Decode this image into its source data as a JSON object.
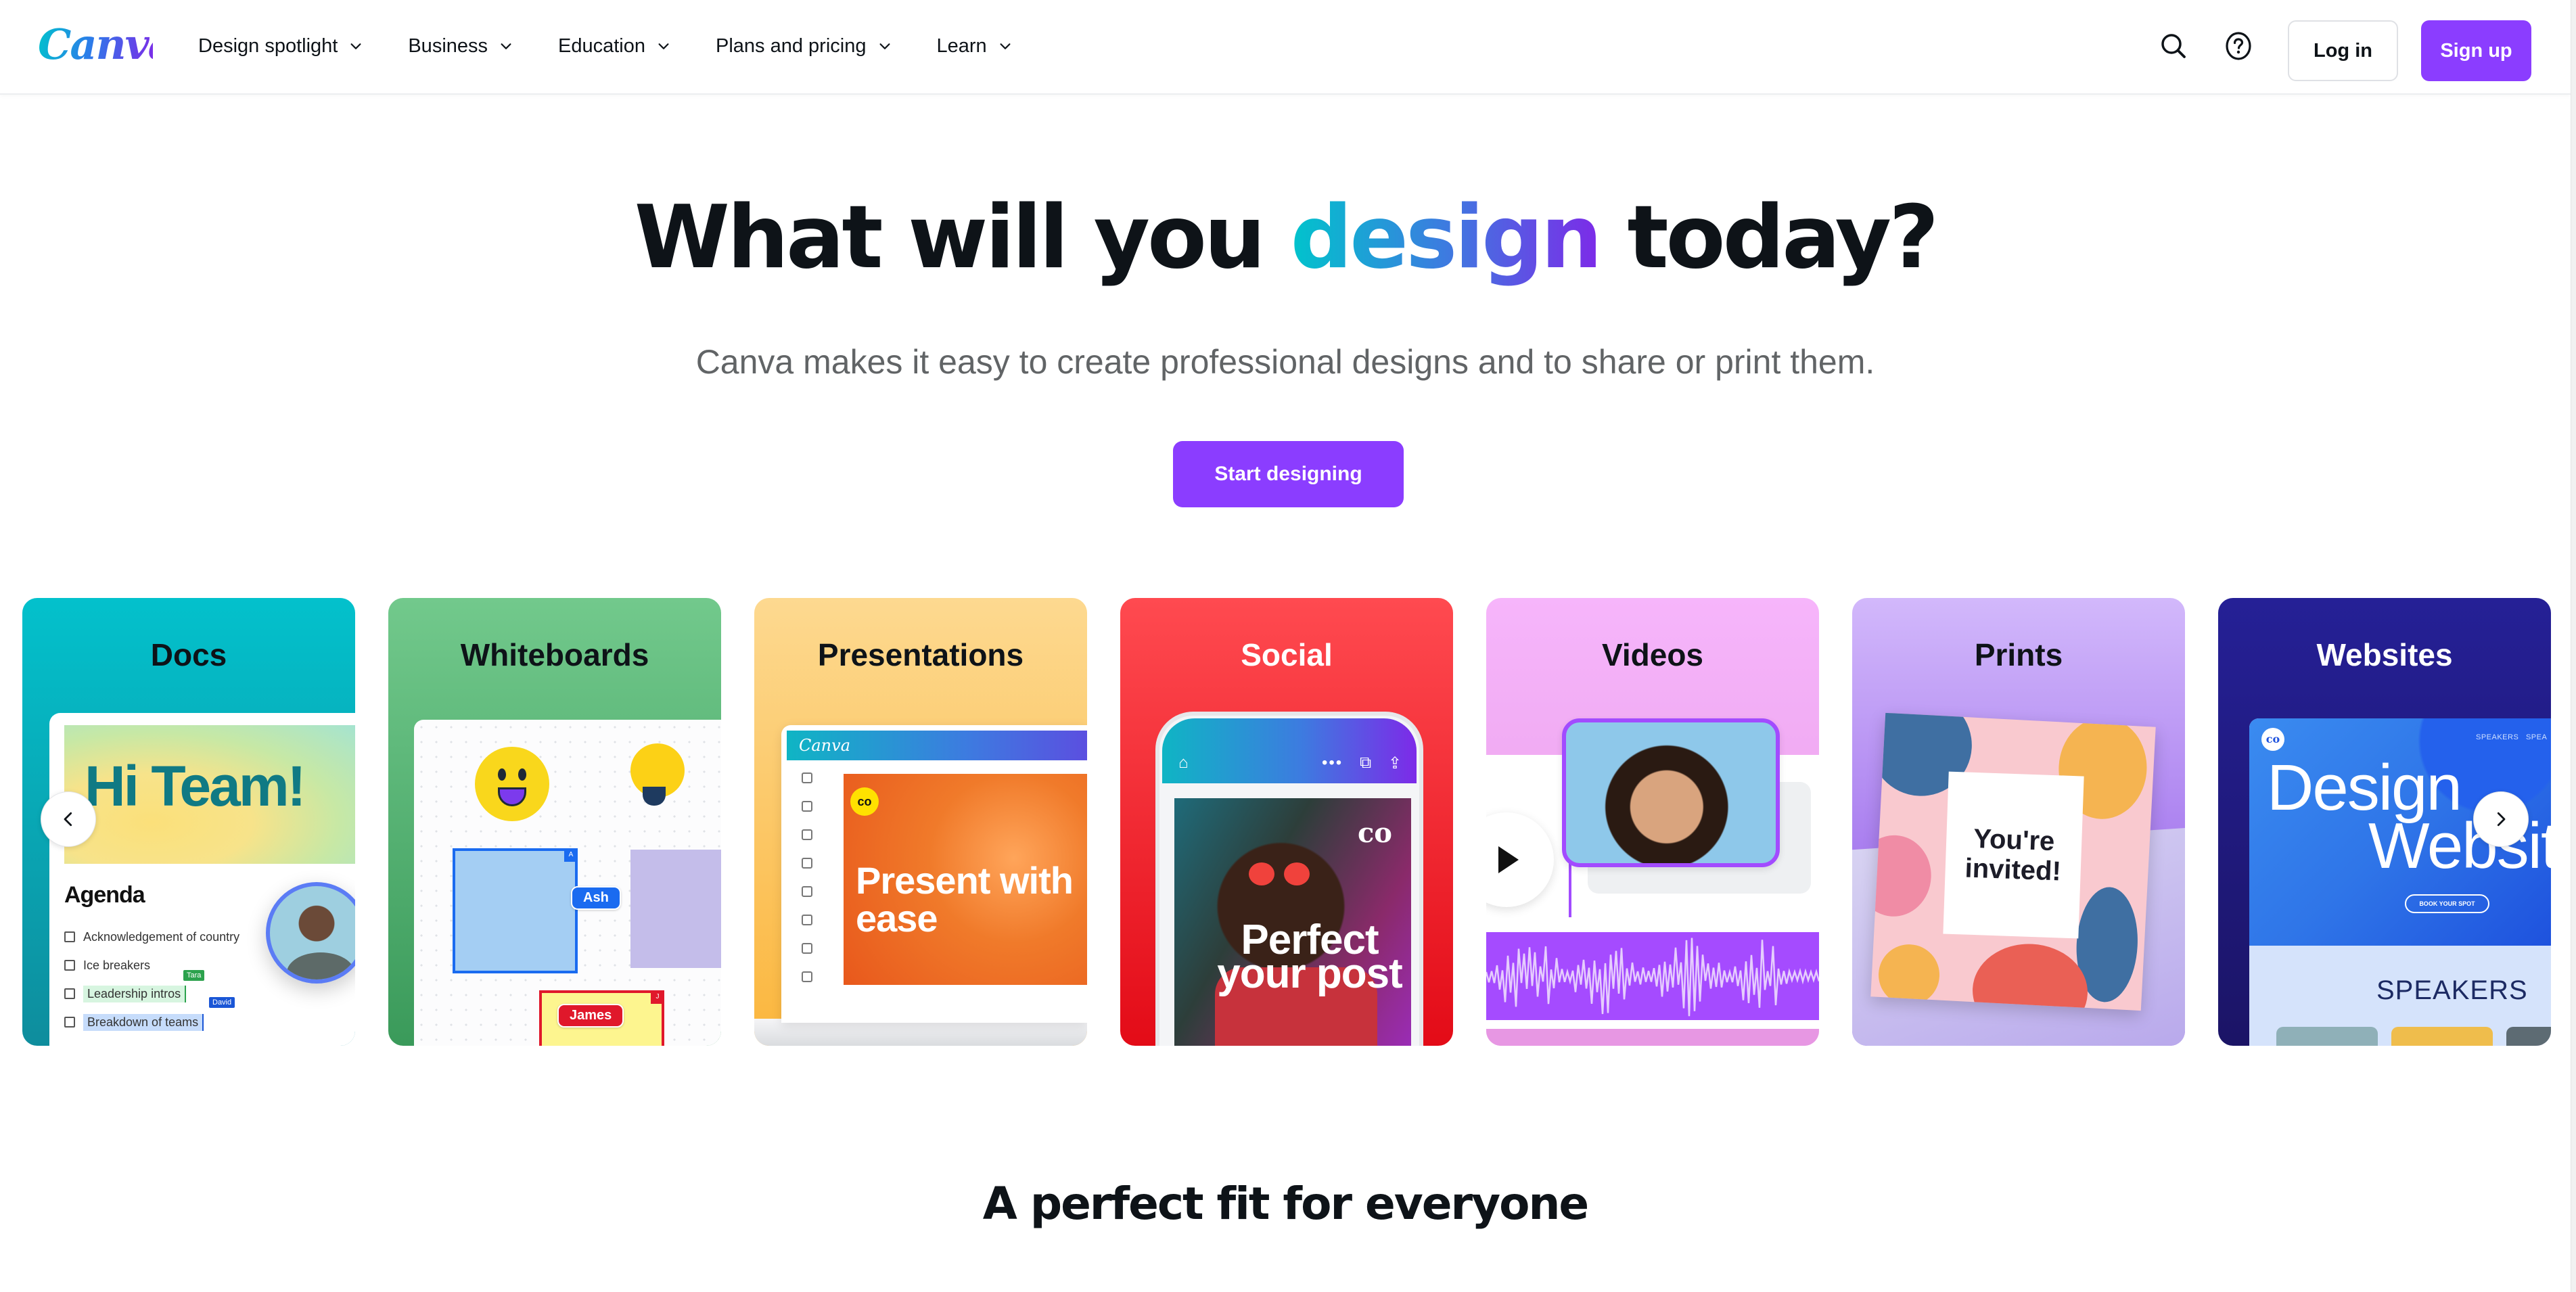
{
  "header": {
    "logo": "Canva",
    "nav": [
      {
        "label": "Design spotlight",
        "icon": "chevron-down-icon"
      },
      {
        "label": "Business",
        "icon": "chevron-down-icon"
      },
      {
        "label": "Education",
        "icon": "chevron-down-icon"
      },
      {
        "label": "Plans and pricing",
        "icon": "chevron-down-icon"
      },
      {
        "label": "Learn",
        "icon": "chevron-down-icon"
      }
    ],
    "search_icon": "search-icon",
    "help_icon": "help-circle-icon",
    "login_label": "Log in",
    "signup_label": "Sign up"
  },
  "hero": {
    "headline_before": "What will you ",
    "headline_accent": "design",
    "headline_after": " today?",
    "subtitle": "Canva makes it easy to create professional designs and to share or print them.",
    "cta_label": "Start designing"
  },
  "colors": {
    "brand_purple": "#8b3dff",
    "gradient_start": "#00c4cc",
    "gradient_end": "#7d2ae8",
    "text_dark": "#0e1318",
    "text_gray": "#616466"
  },
  "carousel": {
    "prev_icon": "chevron-left-icon",
    "next_icon": "chevron-right-icon",
    "cards": [
      {
        "title": "Docs",
        "bg_top": "#03c1cc",
        "bg_bottom": "#0e8d9d",
        "title_color": "#0e1318",
        "preview": {
          "heading": "Hi Team!",
          "subheading": "Agenda",
          "items": [
            "Acknowledgement of country",
            "Ice breakers",
            "Leadership intros",
            "Breakdown of teams"
          ],
          "tags": [
            "Tara",
            "David"
          ]
        }
      },
      {
        "title": "Whiteboards",
        "bg_top": "#72c98c",
        "bg_bottom": "#3a9a5a",
        "title_color": "#0e1318",
        "preview": {
          "collaborators": [
            "Ash",
            "James"
          ],
          "corner_tags": [
            "A",
            "J"
          ]
        }
      },
      {
        "title": "Presentations",
        "bg_top": "#fdd990",
        "bg_bottom": "#fbb63d",
        "title_color": "#0e1318",
        "preview": {
          "app_name": "Canva",
          "slide_text": "Present with ease",
          "badge": "co"
        }
      },
      {
        "title": "Social",
        "bg_top": "#ff4a50",
        "bg_bottom": "#e30b17",
        "title_color": "#ffffff",
        "preview": {
          "post_text": "Perfect your post",
          "badge": "co"
        }
      },
      {
        "title": "Videos",
        "bg_top": "#f6b5fb",
        "bg_bottom": "#e79ae4",
        "title_color": "#0e1318",
        "preview": {}
      },
      {
        "title": "Prints",
        "bg_top": "#d2b8fb",
        "bg_bottom": "#8a52e6",
        "title_color": "#0e1318",
        "preview": {
          "card_text": "You're invited!"
        }
      },
      {
        "title": "Websites",
        "bg_top": "#252096",
        "bg_bottom": "#1b1466",
        "title_color": "#ffffff",
        "preview": {
          "nav": "SPEAKERS   SPEA",
          "title_line1": "Design",
          "title_line2": "Websit",
          "button": "BOOK YOUR SPOT",
          "section": "SPEAKERS",
          "badge": "co"
        }
      }
    ]
  },
  "section": {
    "title": "A perfect fit for everyone"
  }
}
